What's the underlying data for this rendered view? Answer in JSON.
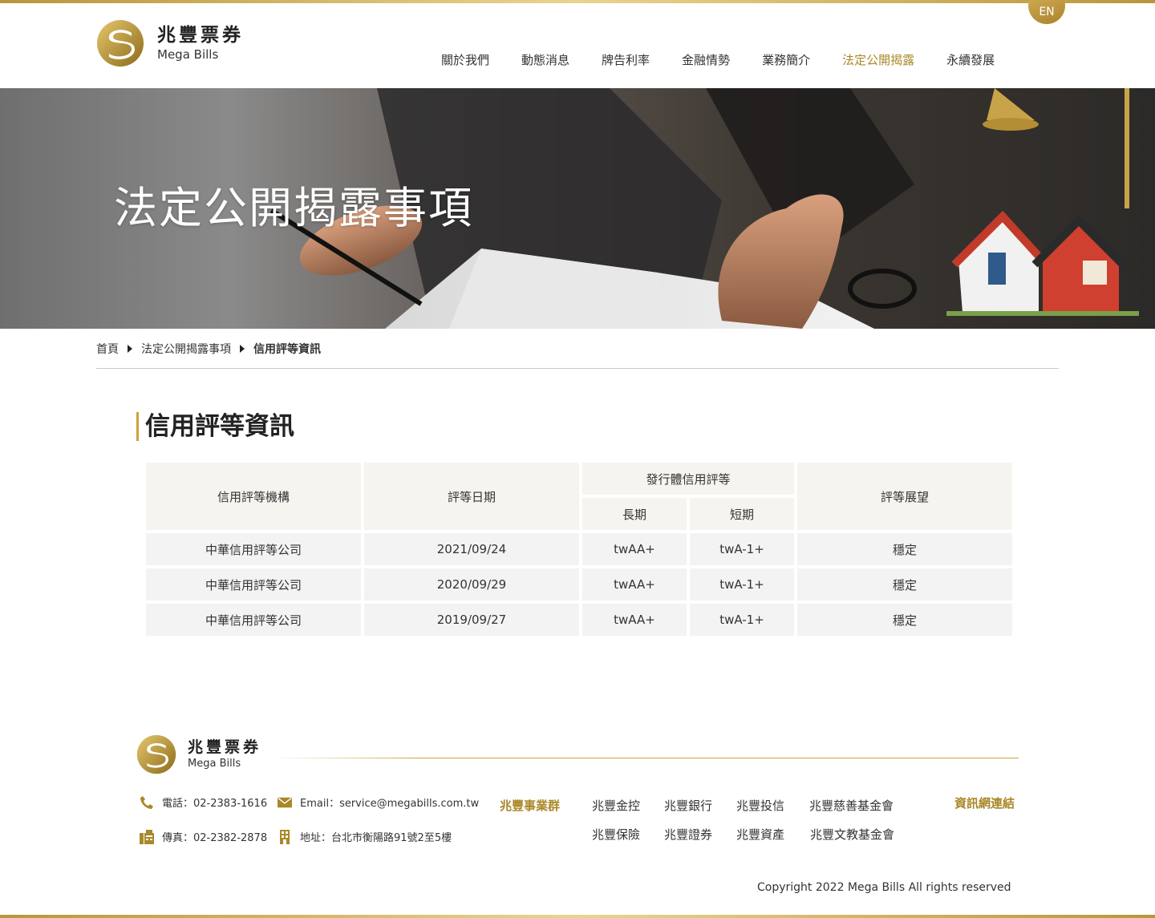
{
  "colors": {
    "accent_gold": "#a98828",
    "gold_light": "#e9d48f",
    "header_cell_bg": "#f6f4ef",
    "row_cell_bg": "#f3f3f3"
  },
  "header": {
    "logo_cn": "兆豐票券",
    "logo_en": "Mega Bills",
    "lang_button": "EN",
    "nav": [
      {
        "label": "關於我們"
      },
      {
        "label": "動態消息"
      },
      {
        "label": "牌告利率"
      },
      {
        "label": "金融情勢"
      },
      {
        "label": "業務簡介"
      },
      {
        "label": "法定公開揭露",
        "active": true
      },
      {
        "label": "永續發展"
      }
    ]
  },
  "banner": {
    "title": "法定公開揭露事項"
  },
  "breadcrumb": [
    {
      "label": "首頁"
    },
    {
      "label": "法定公開揭露事項"
    },
    {
      "label": "信用評等資訊"
    }
  ],
  "section": {
    "title": "信用評等資訊"
  },
  "table": {
    "headers": {
      "agency": "信用評等機構",
      "date": "評等日期",
      "issuer_rating": "發行體信用評等",
      "long_term": "長期",
      "short_term": "短期",
      "outlook": "評等展望"
    },
    "rows": [
      {
        "agency": "中華信用評等公司",
        "date": "2021/09/24",
        "long_term": "twAA+",
        "short_term": "twA-1+",
        "outlook": "穩定"
      },
      {
        "agency": "中華信用評等公司",
        "date": "2020/09/29",
        "long_term": "twAA+",
        "short_term": "twA-1+",
        "outlook": "穩定"
      },
      {
        "agency": "中華信用評等公司",
        "date": "2019/09/27",
        "long_term": "twAA+",
        "short_term": "twA-1+",
        "outlook": "穩定"
      }
    ]
  },
  "footer": {
    "logo_cn": "兆豐票券",
    "logo_en": "Mega Bills",
    "phone": "電話：02-2383-1616",
    "email": "Email：service@megabills.com.tw",
    "fax": "傳真：02-2382-2878",
    "address": "地址：台北市衡陽路91號2至5樓",
    "group_label": "兆豐事業群",
    "group_links": [
      "兆豐金控",
      "兆豐銀行",
      "兆豐投信",
      "兆豐慈善基金會",
      "兆豐保險",
      "兆豐證券",
      "兆豐資產",
      "兆豐文教基金會"
    ],
    "info_link": "資訊網連結",
    "copyright": "Copyright 2022 Mega Bills All rights reserved"
  }
}
